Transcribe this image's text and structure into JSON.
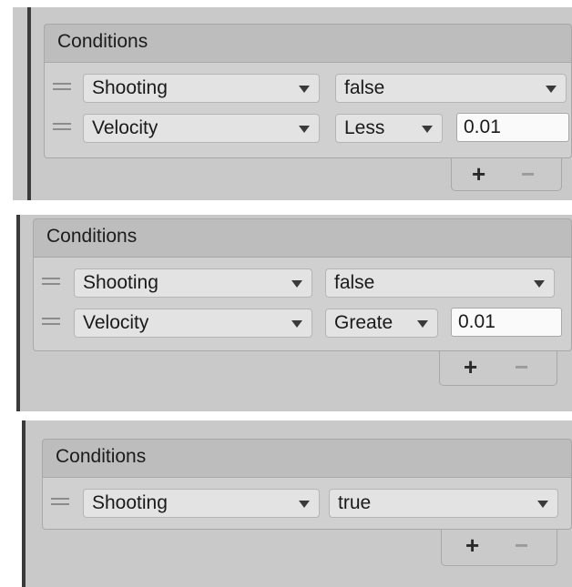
{
  "panels": [
    {
      "header": "Conditions",
      "rows": [
        {
          "parameter": "Shooting",
          "value": "false"
        },
        {
          "parameter": "Velocity",
          "mode": "Less",
          "threshold": "0.01"
        }
      ],
      "add_label": "+",
      "remove_label": "−"
    },
    {
      "header": "Conditions",
      "rows": [
        {
          "parameter": "Shooting",
          "value": "false"
        },
        {
          "parameter": "Velocity",
          "mode": "Greate",
          "threshold": "0.01"
        }
      ],
      "add_label": "+",
      "remove_label": "−"
    },
    {
      "header": "Conditions",
      "rows": [
        {
          "parameter": "Shooting",
          "value": "true"
        }
      ],
      "add_label": "+",
      "remove_label": "−"
    }
  ]
}
